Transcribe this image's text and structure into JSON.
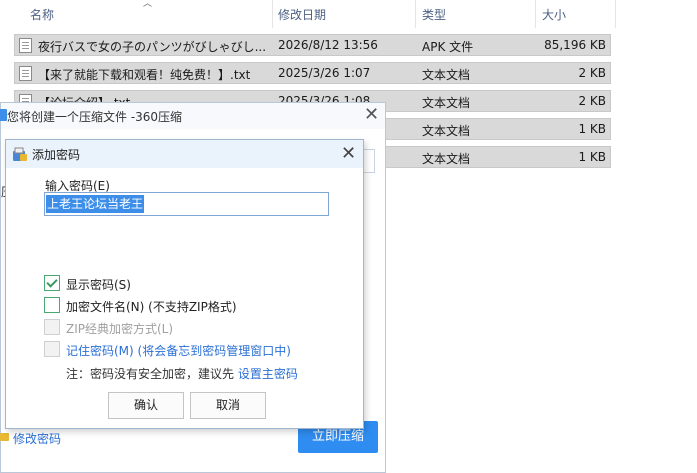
{
  "explorer": {
    "columns": {
      "name": "名称",
      "date": "修改日期",
      "type": "类型",
      "size": "大小"
    },
    "rows": [
      {
        "name": "夜行バスで女の子のパンツがびしゃびし...",
        "date": "2026/8/12 13:56",
        "type": "APK 文件",
        "size": "85,196 KB"
      },
      {
        "name": "【来了就能下载和观看！纯免费！】.txt",
        "date": "2025/3/26 1:07",
        "type": "文本文档",
        "size": "2 KB"
      },
      {
        "name": "【论坛介绍】.txt",
        "date": "2025/3/26 1:08",
        "type": "文本文档",
        "size": "2 KB"
      },
      {
        "name": "",
        "date": "",
        "type": "文本文档",
        "size": "1 KB"
      },
      {
        "name": "",
        "date": "",
        "type": "文本文档",
        "size": "1 KB"
      }
    ]
  },
  "zip_window": {
    "title": "您将创建一个压缩文件 -360压缩",
    "left_glyph": "压",
    "modify_password": "修改密码",
    "compress_now": "立即压缩"
  },
  "dialog": {
    "title": "添加密码",
    "password_label": "输入密码(E)",
    "password_value": "上老王论坛当老王",
    "options": {
      "show_password": {
        "label": "显示密码(S)",
        "checked": true
      },
      "encrypt_names": {
        "label": "加密文件名(N) (不支持ZIP格式)",
        "checked": false
      },
      "zip_classic": {
        "label": "ZIP经典加密方式(L)",
        "checked": false,
        "disabled": true
      },
      "remember": {
        "label": "记住密码(M) (将会备忘到密码管理窗口中)",
        "checked": false,
        "disabled": true
      }
    },
    "note_prefix": "注：密码没有安全加密，建议先",
    "note_link": "设置主密码",
    "ok": "确认",
    "cancel": "取消"
  },
  "colors": {
    "accent": "#2f8cf0",
    "link": "#2a6fd6",
    "check": "#3a9a60",
    "selection": "#d9d9d9"
  },
  "icons": [
    "sort-up-icon",
    "text-file-icon",
    "close-icon",
    "password-dialog-icon",
    "lock-icon",
    "check-icon"
  ]
}
